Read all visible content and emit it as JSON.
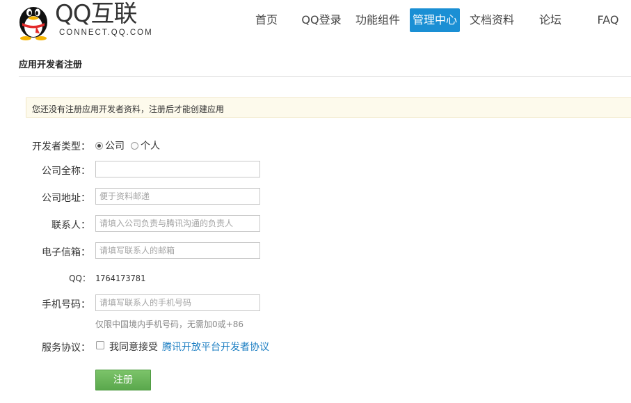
{
  "logo": {
    "main": "QQ互联",
    "sub": "CONNECT.QQ.COM"
  },
  "nav": {
    "items": [
      {
        "label": "首页"
      },
      {
        "label": "QQ登录"
      },
      {
        "label": "功能组件"
      },
      {
        "label": "管理中心",
        "active": true
      },
      {
        "label": "文档资料"
      },
      {
        "label": "论坛"
      },
      {
        "label": "FAQ"
      }
    ]
  },
  "page": {
    "title": "应用开发者注册"
  },
  "notice": {
    "text": "您还没有注册应用开发者资料，注册后才能创建应用"
  },
  "form": {
    "dev_type": {
      "label": "开发者类型：",
      "options": [
        "公司",
        "个人"
      ],
      "selected": "公司"
    },
    "company_name": {
      "label": "公司全称：",
      "value": "",
      "placeholder": ""
    },
    "company_address": {
      "label": "公司地址：",
      "value": "",
      "placeholder": "便于资料邮递"
    },
    "contact": {
      "label": "联系人：",
      "value": "",
      "placeholder": "请填入公司负责与腾讯沟通的负责人"
    },
    "email": {
      "label": "电子信箱：",
      "value": "",
      "placeholder": "请填写联系人的邮箱"
    },
    "qq": {
      "label": "QQ：",
      "value": "1764173781"
    },
    "phone": {
      "label": "手机号码：",
      "value": "",
      "placeholder": "请填写联系人的手机号码",
      "hint": "仅限中国境内手机号码，无需加0或+86"
    },
    "agreement": {
      "label": "服务协议：",
      "agree_text": "我同意接受",
      "link_text": "腾讯开放平台开发者协议",
      "checked": false
    },
    "submit_label": "注册"
  },
  "colors": {
    "nav_active": "#1a8fd4",
    "link": "#1a7dc2",
    "button_green": "#5aa84c",
    "notice_bg": "#fdfaec"
  }
}
